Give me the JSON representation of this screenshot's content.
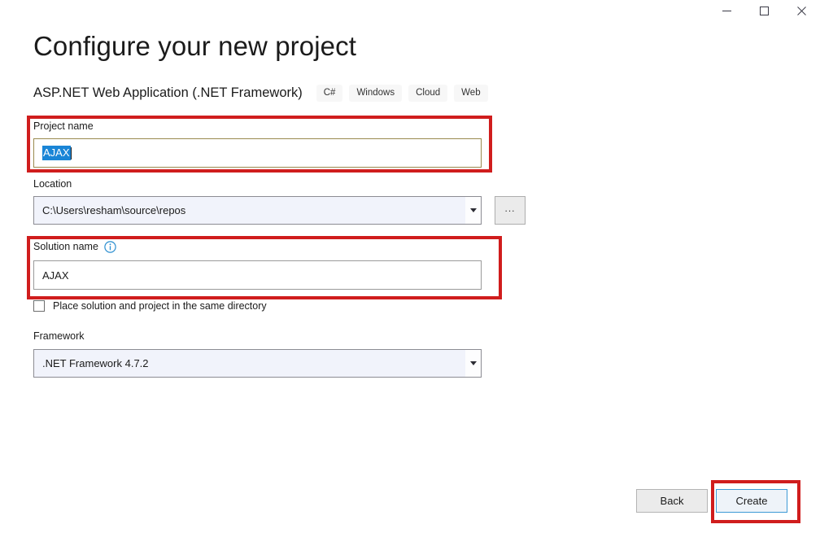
{
  "window": {
    "controls": [
      {
        "name": "minimize",
        "glyph": "minimize-icon"
      },
      {
        "name": "maximize",
        "glyph": "maximize-icon"
      },
      {
        "name": "close",
        "glyph": "close-icon"
      }
    ]
  },
  "header": {
    "title": "Configure your new project",
    "subtitle": "ASP.NET Web Application (.NET Framework)",
    "tags": [
      "C#",
      "Windows",
      "Cloud",
      "Web"
    ]
  },
  "form": {
    "project_name": {
      "label": "Project name",
      "value": "AJAX",
      "selected": true,
      "focused": true
    },
    "location": {
      "label": "Location",
      "value": "C:\\Users\\resham\\source\\repos",
      "browse_label": "...",
      "dropdown_icon": "chevron-down-icon"
    },
    "solution_name": {
      "label": "Solution name",
      "info_icon": "info-icon",
      "value": "AJAX"
    },
    "same_directory": {
      "label": "Place solution and project in the same directory",
      "checked": false
    },
    "framework": {
      "label": "Framework",
      "value": ".NET Framework 4.7.2",
      "dropdown_icon": "chevron-down-icon"
    }
  },
  "footer": {
    "back_label": "Back",
    "create_label": "Create"
  },
  "colors": {
    "annotation": "#d01d1d",
    "selection": "#1a85d6",
    "primary_border": "#3d9ad6",
    "focus_border": "#9a8a4e",
    "combo_fill": "#f1f3fb"
  }
}
